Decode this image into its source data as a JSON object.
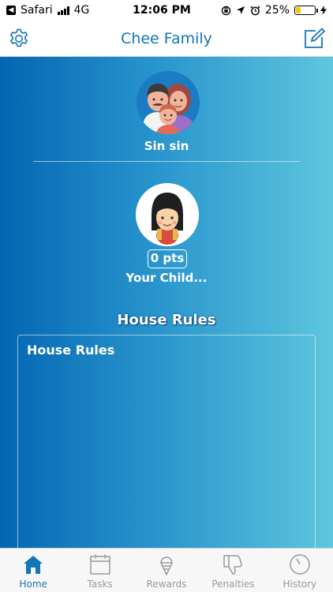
{
  "status_bar": {
    "carrier": "Safari",
    "network": "4G",
    "time": "12:06 PM",
    "battery": "25%",
    "battery_level": 0.25
  },
  "nav": {
    "title": "Chee Family",
    "left_icon": "gear-icon",
    "right_icon": "edit-icon"
  },
  "parent": {
    "name": "Sin sin",
    "avatar_icon": "family-avatar-icon"
  },
  "child": {
    "points": "0 pts",
    "name": "Your Child...",
    "avatar_icon": "child-avatar-icon"
  },
  "house_rules": {
    "heading": "House Rules",
    "box_label": "House Rules"
  },
  "tabs": [
    {
      "label": "Home",
      "icon": "home-icon",
      "active": true
    },
    {
      "label": "Tasks",
      "icon": "calendar-icon",
      "active": false
    },
    {
      "label": "Rewards",
      "icon": "ice-cream-icon",
      "active": false
    },
    {
      "label": "Penalties",
      "icon": "thumbs-down-icon",
      "active": false
    },
    {
      "label": "History",
      "icon": "clock-icon",
      "active": false
    }
  ],
  "colors": {
    "accent": "#1276b8",
    "gradient_start": "#0466b2",
    "gradient_end": "#5ec6de"
  }
}
